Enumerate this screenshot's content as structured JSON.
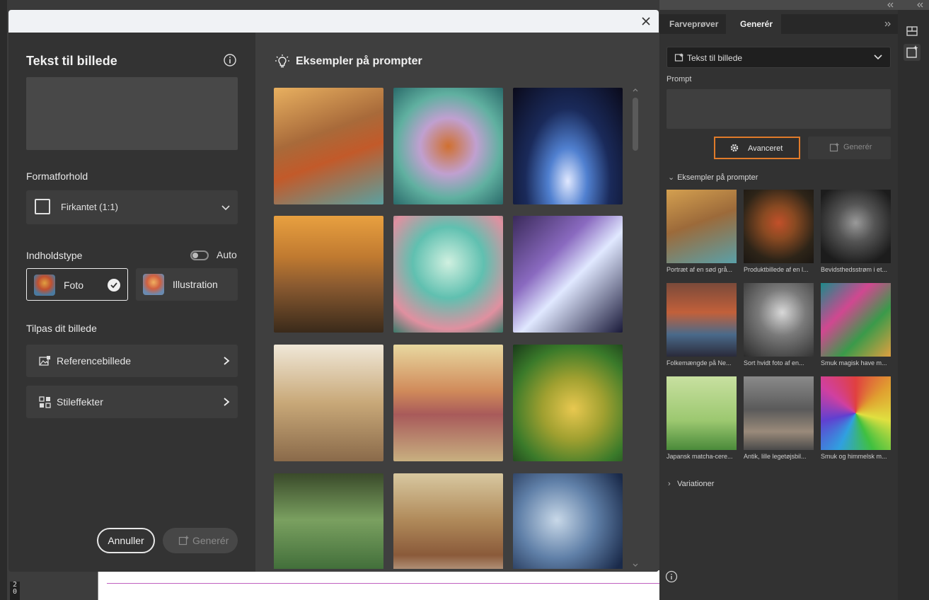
{
  "dialog": {
    "left": {
      "title": "Tekst til billede",
      "aspect_heading": "Formatforhold",
      "aspect_value": "Firkantet (1:1)",
      "content_heading": "Indholdstype",
      "auto_label": "Auto",
      "content_types": [
        "Foto",
        "Illustration"
      ],
      "adjust_heading": "Tilpas dit billede",
      "reference_label": "Referencebillede",
      "style_label": "Stileffekter",
      "cancel_label": "Annuller",
      "generate_label": "Generér"
    },
    "right": {
      "title": "Eksempler på prompter"
    }
  },
  "panel": {
    "tabs": [
      "Farveprøver",
      "Generér"
    ],
    "mode_select": "Tekst til billede",
    "prompt_label": "Prompt",
    "advanced_label": "Avanceret",
    "generate_label": "Generér",
    "examples_label": "Eksempler på prompter",
    "variations_label": "Variationer",
    "thumbnails": [
      "Portræt af en sød grå...",
      "Produktbillede af en l...",
      "Bevidsthedsstrøm i et...",
      "Folkemængde på Ne...",
      "Sort hvidt foto af en...",
      "Smuk magisk have m...",
      "Japansk matcha-cere...",
      "Antik, lille legetøjsbil...",
      "Smuk og himmelsk m..."
    ]
  },
  "ruler": {
    "numbers": "2 0"
  },
  "colors": {
    "accent_outline": "#e07b2a"
  }
}
